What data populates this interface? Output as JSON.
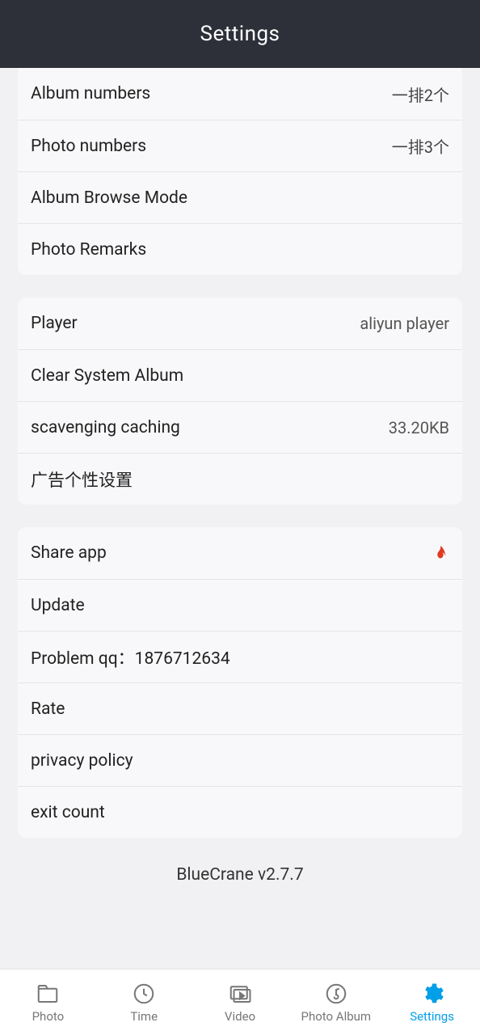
{
  "header": {
    "title": "Settings"
  },
  "group1": {
    "album_numbers": {
      "label": "Album numbers",
      "value": "一排2个"
    },
    "photo_numbers": {
      "label": "Photo numbers",
      "value": "一排3个"
    },
    "browse_mode": {
      "label": "Album Browse Mode"
    },
    "photo_remarks": {
      "label": "Photo Remarks"
    }
  },
  "group2": {
    "player": {
      "label": "Player",
      "value": "aliyun player"
    },
    "clear_album": {
      "label": "Clear System Album"
    },
    "cache": {
      "label": "scavenging caching",
      "value": "33.20KB"
    },
    "ad_settings": {
      "label": "广告个性设置"
    }
  },
  "group3": {
    "share": {
      "label": "Share app"
    },
    "update": {
      "label": "Update"
    },
    "problem": {
      "label": "Problem qq：1876712634"
    },
    "rate": {
      "label": "Rate"
    },
    "privacy": {
      "label": "privacy policy"
    },
    "exit": {
      "label": "exit count"
    }
  },
  "version": "BlueCrane v2.7.7",
  "tabs": {
    "photo": "Photo",
    "time": "Time",
    "video": "Video",
    "photo_album": "Photo Album",
    "settings": "Settings"
  }
}
